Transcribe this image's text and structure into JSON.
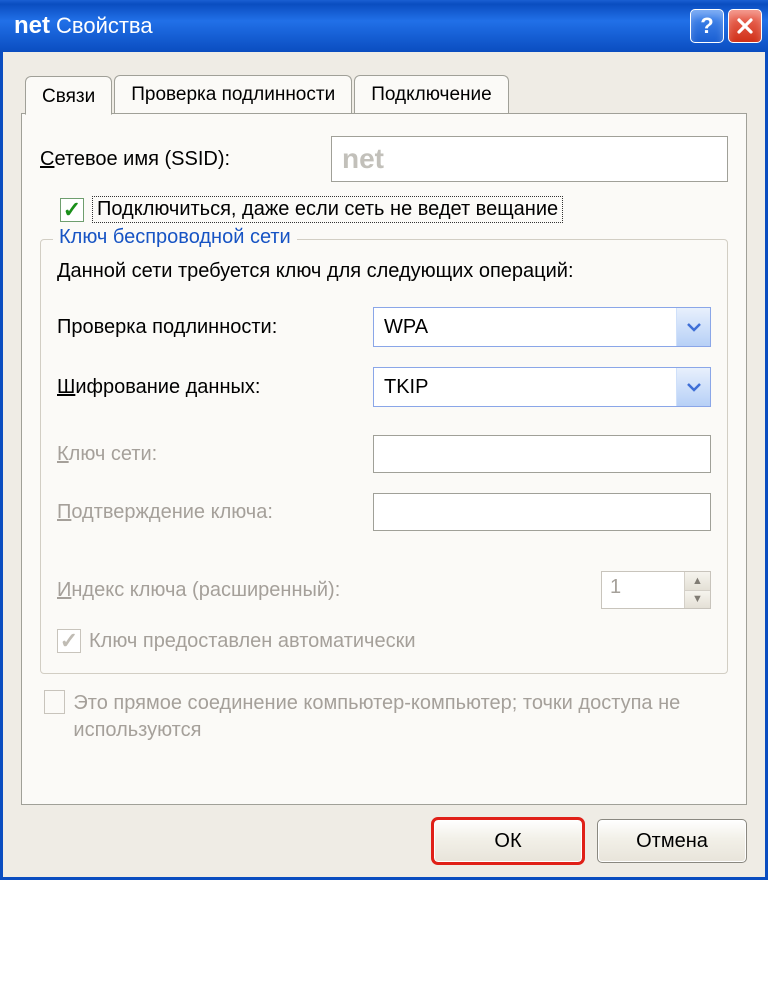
{
  "titlebar": {
    "strong": "net",
    "rest": "Свойства",
    "help_tooltip": "?",
    "close_tooltip": "✕"
  },
  "tabs": {
    "connections": "Связи",
    "auth": "Проверка подлинности",
    "connect": "Подключение"
  },
  "ssid": {
    "label_pre": "С",
    "label_post": "етевое имя (SSID):",
    "value": "net"
  },
  "connect_hidden": {
    "label": "Подключиться, даже если сеть не ведет вещание",
    "checked": true
  },
  "group": {
    "title": "Ключ беспроводной сети",
    "desc": "Данной сети требуется ключ для следующих операций:",
    "auth_label": "Проверка подлинности:",
    "auth_value": "WPA",
    "enc_label_pre": "Ш",
    "enc_label_post": "ифрование данных:",
    "enc_value": "TKIP",
    "key_label_pre": "К",
    "key_label_post": "люч сети:",
    "key_value": "",
    "confirm_label_pre": "П",
    "confirm_label_post": "одтверждение ключа:",
    "confirm_value": "",
    "index_label_pre": "И",
    "index_label_post": "ндекс ключа (расширенный):",
    "index_value": "1",
    "autokey_label": "Ключ предоставлен автоматически",
    "autokey_checked": true
  },
  "adhoc": {
    "label": "Это прямое соединение компьютер-компьютер; точки доступа не используются",
    "checked": false
  },
  "buttons": {
    "ok": "ОК",
    "cancel": "Отмена"
  }
}
